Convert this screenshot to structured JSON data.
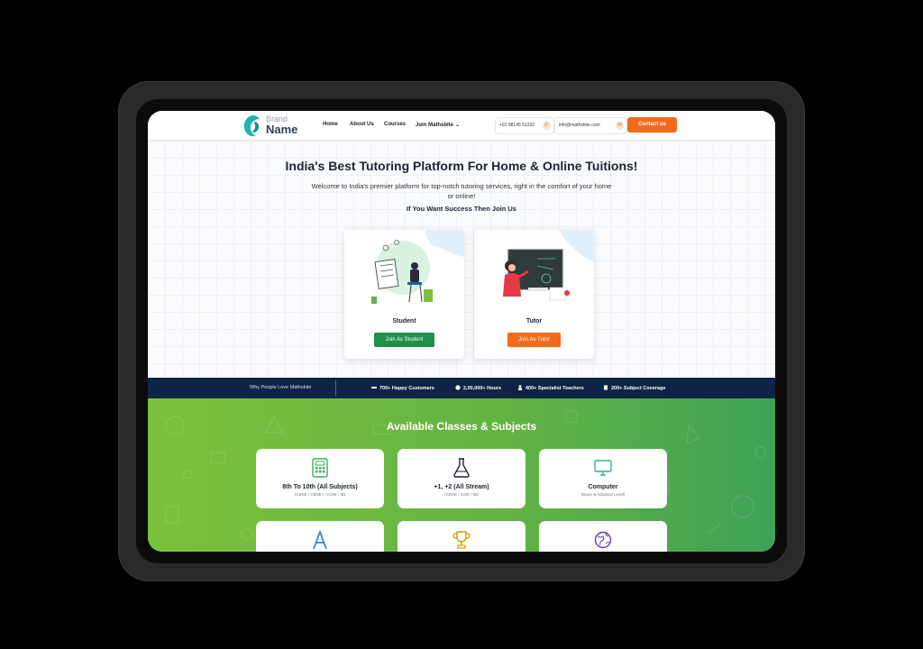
{
  "colors": {
    "accent_orange": "#f26a1b",
    "accent_green": "#1f8f4a",
    "navy": "#0f2444",
    "section_green": "#64b443"
  },
  "header": {
    "logo_brand": "Brand",
    "logo_name": "Name",
    "nav": [
      "Home",
      "About Us",
      "Courses",
      "Join Mathsbite"
    ],
    "phone": "+91 98145 51232",
    "email": "info@mathsbite.com",
    "contact_label": "Contact us"
  },
  "hero": {
    "title": "India's Best Tutoring Platform For Home & Online Tuitions!",
    "subtitle": "Welcome to India's premier platform for top-notch tutoring services, right in the comfort of your home or online!",
    "cta": "If You Want Success Then Join Us",
    "cards": [
      {
        "label": "Student",
        "button": "Join As Student"
      },
      {
        "label": "Tutor",
        "button": "Join As Tutor"
      }
    ]
  },
  "stats": {
    "lead": "Why People Love Mathsbite",
    "items": [
      {
        "icon": "handshake-icon",
        "text": "700+ Happy Customers"
      },
      {
        "icon": "clock-icon",
        "text": "2,00,000+ Hours"
      },
      {
        "icon": "teacher-icon",
        "text": "400+ Specialist Teachers"
      },
      {
        "icon": "book-icon",
        "text": "200+ Subject Coverage"
      }
    ]
  },
  "classes": {
    "title": "Available Classes & Subjects",
    "items": [
      {
        "icon": "calculator-icon",
        "title": "8th To 10th (All Subjects)",
        "note": "(CBSE / CBSE-I / ICSE / IB)"
      },
      {
        "icon": "flask-icon",
        "title": "+1, +2 (All Stream)",
        "note": "(CBSE / ICSE / IB)"
      },
      {
        "icon": "computer-icon",
        "title": "Computer",
        "note": "(Basic & Advance Level)"
      },
      {
        "icon": "letter-a-icon",
        "title": "",
        "note": ""
      },
      {
        "icon": "trophy-icon",
        "title": "",
        "note": ""
      },
      {
        "icon": "globe-icon",
        "title": "",
        "note": ""
      }
    ]
  }
}
